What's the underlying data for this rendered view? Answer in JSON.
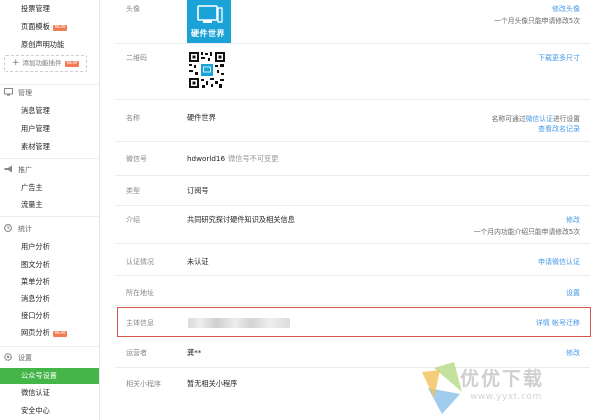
{
  "sidebar": {
    "top_items": [
      {
        "label": "投票管理",
        "badge": ""
      },
      {
        "label": "页面模板",
        "badge": "NEW"
      },
      {
        "label": "原创声明功能",
        "badge": ""
      }
    ],
    "add_plugin": {
      "label": "添加功能插件",
      "badge": "NEW"
    },
    "sections": [
      {
        "title": "管理",
        "icon": "monitor-icon",
        "items": [
          {
            "label": "消息管理"
          },
          {
            "label": "用户管理"
          },
          {
            "label": "素材管理"
          }
        ]
      },
      {
        "title": "推广",
        "icon": "megaphone-icon",
        "items": [
          {
            "label": "广告主"
          },
          {
            "label": "流量主"
          }
        ]
      },
      {
        "title": "统计",
        "icon": "clock-icon",
        "items": [
          {
            "label": "用户分析"
          },
          {
            "label": "图文分析"
          },
          {
            "label": "菜单分析"
          },
          {
            "label": "消息分析"
          },
          {
            "label": "接口分析"
          },
          {
            "label": "网页分析",
            "badge": "NEW"
          }
        ]
      },
      {
        "title": "设置",
        "icon": "gear-icon",
        "items": [
          {
            "label": "公众号设置",
            "active": true
          },
          {
            "label": "微信认证"
          },
          {
            "label": "安全中心"
          }
        ]
      }
    ],
    "accent": "#44b549"
  },
  "settings": {
    "avatar": {
      "label": "头像",
      "image_text": "硬件世界",
      "action": "修改头像",
      "note": "一个月头像只能申请修改5次"
    },
    "qrcode": {
      "label": "二维码",
      "action": "下载更多尺寸"
    },
    "name": {
      "label": "名称",
      "value": "硬件世界",
      "note_prefix": "名称可通过",
      "note_link": "微信认证",
      "note_suffix": "进行设置",
      "action": "查看改名记录"
    },
    "wechat_id": {
      "label": "微信号",
      "value": "hdworld16",
      "note": "微信号不可变更"
    },
    "type": {
      "label": "类型",
      "value": "订阅号"
    },
    "intro": {
      "label": "介绍",
      "value": "共同研究探讨硬件知识及相关信息",
      "action": "修改",
      "note": "一个月内功能介绍只能申请修改5次"
    },
    "verification": {
      "label": "认证情况",
      "value": "未认证",
      "action": "申请微信认证"
    },
    "address": {
      "label": "所在地址",
      "action": "设置"
    },
    "entity": {
      "label": "主体信息",
      "action1": "详情",
      "action2": "帐号迁移"
    },
    "operator": {
      "label": "运营者",
      "value": "龚**",
      "action": "修改"
    },
    "mini_program": {
      "label": "相关小程序",
      "value": "暂无相关小程序"
    }
  },
  "watermark": {
    "text": "优优下载",
    "url": "www.yyxt.com"
  },
  "colors": {
    "link": "#459ae9",
    "highlight": "#d9534f",
    "badge": "#f17b54"
  }
}
